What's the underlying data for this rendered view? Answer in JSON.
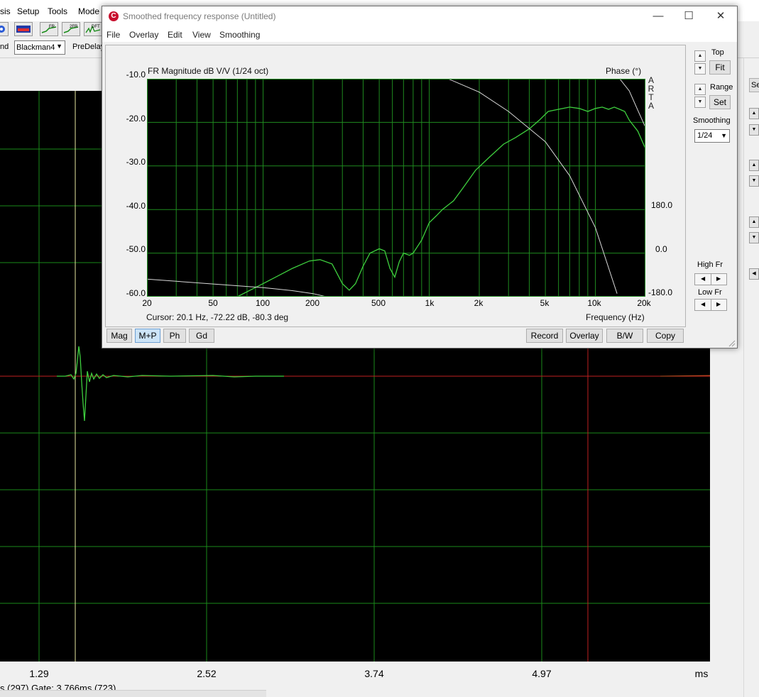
{
  "main_window": {
    "menu": [
      "sis",
      "Setup",
      "Tools",
      "Mode"
    ],
    "toolbar_icons": [
      "speaker-icon",
      "spectrum-icon",
      "fr-icon",
      "2fr-icon",
      "dft-icon"
    ],
    "toolbar_icon_labels": [
      "FR",
      "2FR",
      "DFT"
    ],
    "options": {
      "label_left": "nd",
      "window_select": "Blackman4",
      "predelay_label": "PreDelay"
    },
    "x_ticks": [
      "1.29",
      "2.52",
      "3.74",
      "4.97"
    ],
    "x_unit": "ms",
    "status": "s (297)  Gate: 3.766ms (723)",
    "right_button_label": "Se"
  },
  "dialog": {
    "title": "Smoothed frequency response (Untitled)",
    "menu": [
      "File",
      "Overlay",
      "Edit",
      "View",
      "Smoothing"
    ],
    "window_buttons": {
      "minimize": "—",
      "maximize": "☐",
      "close": "✕"
    },
    "plot": {
      "title_left": "FR Magnitude dB V/V (1/24 oct)",
      "title_right": "Phase (°)",
      "watermark": [
        "A",
        "R",
        "T",
        "A"
      ],
      "y_ticks": [
        "-10.0",
        "-20.0",
        "-30.0",
        "-40.0",
        "-50.0",
        "-60.0"
      ],
      "phase_ticks": [
        "180.0",
        "0.0",
        "-180.0"
      ],
      "x_ticks": [
        "20",
        "50",
        "100",
        "200",
        "500",
        "1k",
        "2k",
        "5k",
        "10k",
        "20k"
      ],
      "cursor": "Cursor: 20.1 Hz, -72.22 dB, -80.3 deg",
      "x_label": "Frequency (Hz)",
      "colors": {
        "magnitude": "#3ecf3e",
        "phase": "#d8d8d8",
        "grid": "#1f8a1f",
        "background": "#000000"
      }
    },
    "side": {
      "top_label": "Top",
      "fit_button": "Fit",
      "range_label": "Range",
      "set_button": "Set",
      "smoothing_label": "Smoothing",
      "smoothing_value": "1/24",
      "high_fr_label": "High Fr",
      "low_fr_label": "Low Fr"
    },
    "bottom_tabs": [
      "Mag",
      "M+P",
      "Ph",
      "Gd"
    ],
    "bottom_tabs_selected": "M+P",
    "bottom_buttons": [
      "Record",
      "Overlay",
      "B/W",
      "Copy"
    ]
  },
  "chart_data": {
    "type": "line",
    "title": "FR Magnitude dB V/V (1/24 oct)",
    "xlabel": "Frequency (Hz)",
    "ylabel": "FR Magnitude dB V/V",
    "y2label": "Phase (°)",
    "x_scale": "log",
    "xlim": [
      20,
      20000
    ],
    "ylim": [
      -60,
      -10
    ],
    "y2lim": [
      -180,
      180
    ],
    "grid": true,
    "series": [
      {
        "axis": "left",
        "x": [
          70,
          100,
          150,
          190,
          220,
          260,
          300,
          330,
          360,
          400,
          440,
          500,
          540,
          580,
          620,
          660,
          700,
          760,
          800,
          900,
          1000,
          1100,
          1200,
          1400,
          1600,
          1900,
          2300,
          2800,
          3300,
          4000,
          4600,
          5200,
          6000,
          7000,
          8000,
          9000,
          10000,
          11000,
          12000,
          13000,
          14000,
          15000,
          16000,
          18000,
          20000
        ],
        "y": [
          -60,
          -57,
          -53.5,
          -51.8,
          -51.5,
          -52.5,
          -57,
          -58.5,
          -57,
          -53,
          -50,
          -49,
          -49.5,
          -53.5,
          -55.5,
          -52,
          -50,
          -50.5,
          -50,
          -47,
          -43,
          -41.5,
          -40,
          -38,
          -35,
          -31,
          -28,
          -25,
          -23.5,
          -21.5,
          -19.5,
          -17.5,
          -17,
          -16.5,
          -16.8,
          -17.5,
          -16.8,
          -16.5,
          -17,
          -16.5,
          -17,
          -17.5,
          -19.5,
          -22,
          -26
        ]
      },
      {
        "axis": "right",
        "x": [
          20,
          50,
          100,
          150,
          200,
          240
        ],
        "y": [
          -151,
          -159,
          -165,
          -170,
          -175,
          -180
        ]
      },
      {
        "axis": "right",
        "x": [
          1300,
          2000,
          3000,
          5000,
          7000,
          10000,
          13500
        ],
        "y": [
          180,
          158,
          126,
          76,
          20,
          -66,
          -175
        ]
      },
      {
        "axis": "right",
        "x": [
          14000,
          16000,
          18000,
          20000
        ],
        "y": [
          180,
          160,
          128,
          100
        ]
      }
    ]
  }
}
